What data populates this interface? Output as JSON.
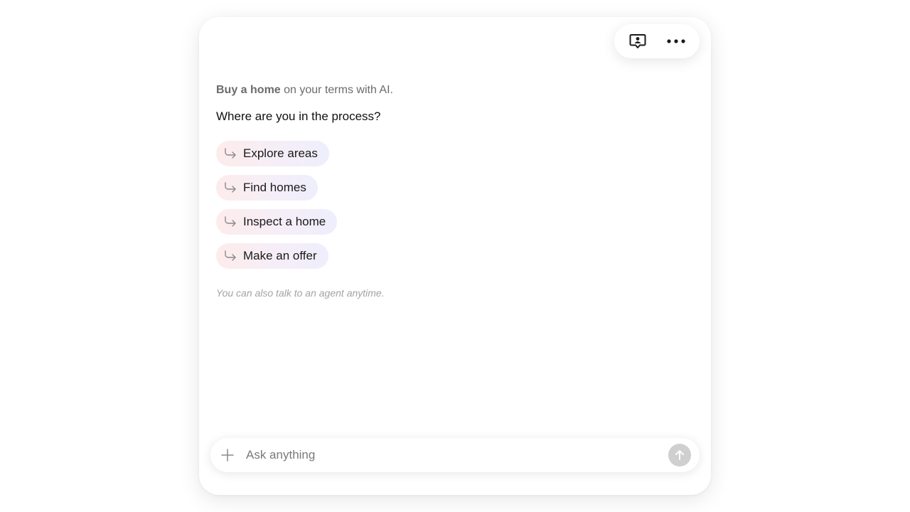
{
  "header": {
    "agent_icon": "agent-chat-icon",
    "more_icon": "more-horizontal-icon"
  },
  "intro": {
    "tagline_bold": "Buy a home",
    "tagline_rest": " on your terms with AI.",
    "question": "Where are you in the process?"
  },
  "options": [
    {
      "label": "Explore areas",
      "icon": "reply-arrow-icon"
    },
    {
      "label": "Find homes",
      "icon": "reply-arrow-icon"
    },
    {
      "label": "Inspect a home",
      "icon": "reply-arrow-icon"
    },
    {
      "label": "Make an offer",
      "icon": "reply-arrow-icon"
    }
  ],
  "note": "You can also talk to an agent anytime.",
  "composer": {
    "placeholder": "Ask anything",
    "value": "",
    "add_icon": "plus-icon",
    "send_icon": "arrow-up-icon"
  },
  "colors": {
    "chip_gradient_start": "#fdeceb",
    "chip_gradient_end": "#eeeefc",
    "send_disabled": "#cfcfcf"
  }
}
